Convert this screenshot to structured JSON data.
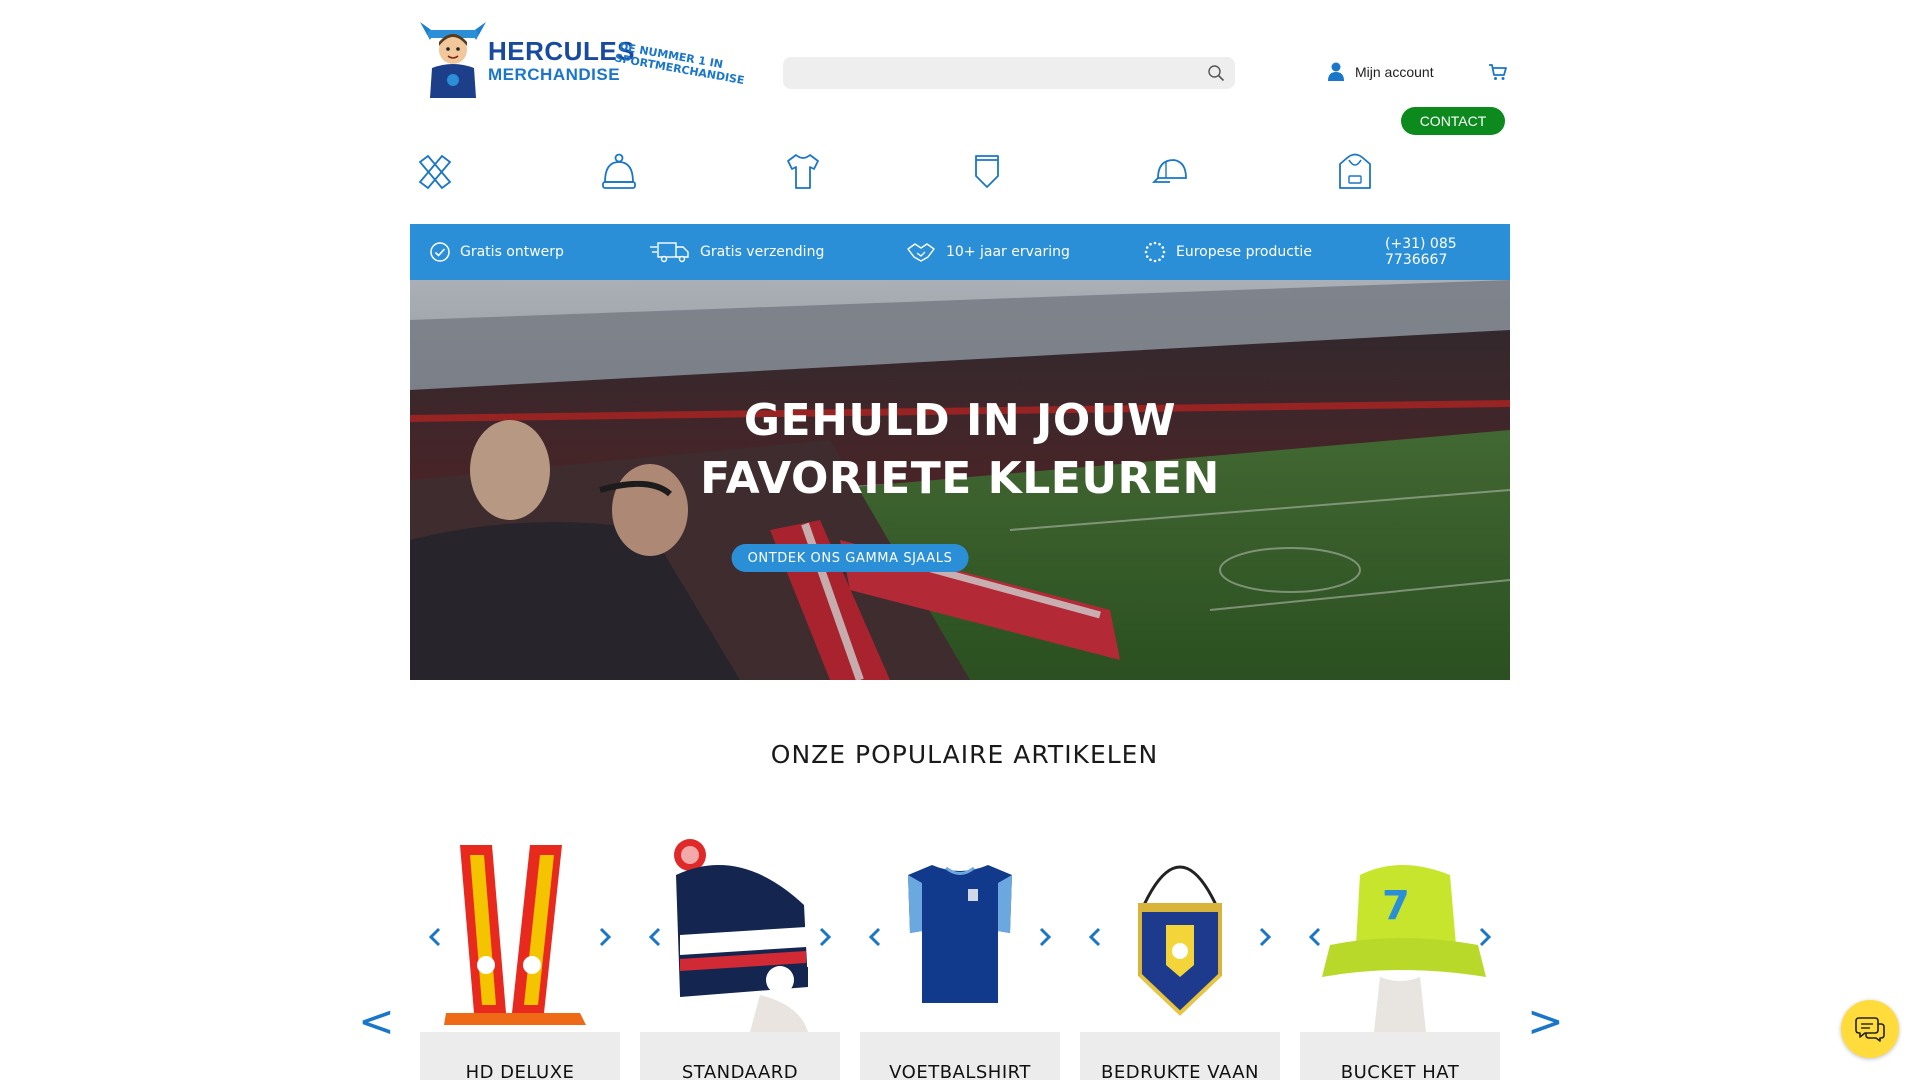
{
  "header": {
    "logo_line1": "HERCULES",
    "logo_line2": "MERCHANDISE",
    "tagline": "DE NUMMER 1 IN SPORTMERCHANDISE",
    "search_placeholder": "",
    "account_label": "Mijn account",
    "contact_label": "CONTACT"
  },
  "categories": [
    "scarves-icon",
    "hat-icon",
    "shirt-icon",
    "pennant-icon",
    "cap-icon",
    "hoodie-icon"
  ],
  "usp": {
    "items": [
      "Gratis ontwerp",
      "Gratis verzending",
      "10+ jaar ervaring",
      "Europese productie"
    ],
    "phone": "(+31) 085 7736667"
  },
  "hero": {
    "title_line1": "GEHULD IN JOUW",
    "title_line2": "FAVORIETE KLEUREN",
    "button_label": "ONTDEK ONS GAMMA SJAALS"
  },
  "popular": {
    "title": "ONZE POPULAIRE ARTIKELEN",
    "prev": "<",
    "next": ">",
    "products": [
      {
        "name": "HD DELUXE"
      },
      {
        "name": "STANDAARD"
      },
      {
        "name": "VOETBALSHIRT"
      },
      {
        "name": "BEDRUKTE VAAN"
      },
      {
        "name": "BUCKET HAT"
      }
    ]
  },
  "colors": {
    "brand_blue": "#2a8fd6",
    "contact_green": "#0c8a1e",
    "chat_yellow": "#ffdc3c"
  }
}
